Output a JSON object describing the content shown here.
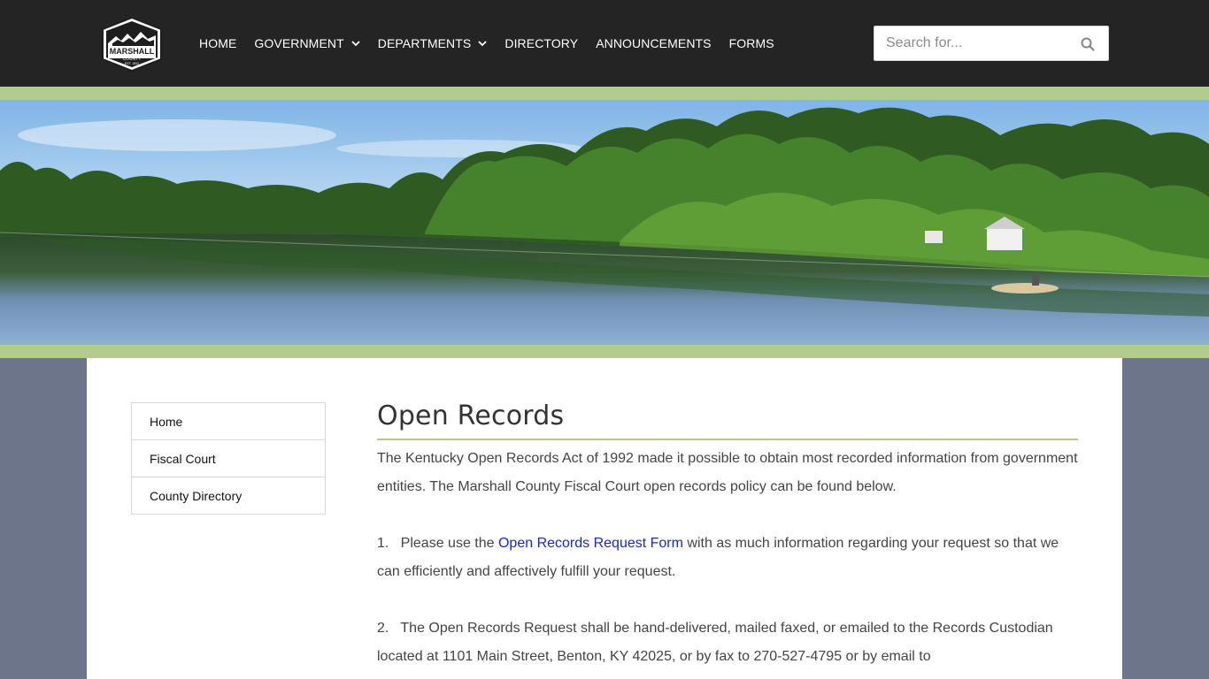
{
  "header": {
    "logo": {
      "name": "MARSHALL",
      "sub": "COUNTY",
      "est": "EST. 1842"
    },
    "nav": [
      {
        "label": "HOME",
        "dropdown": false
      },
      {
        "label": "GOVERNMENT",
        "dropdown": true
      },
      {
        "label": "DEPARTMENTS",
        "dropdown": true
      },
      {
        "label": "DIRECTORY",
        "dropdown": false
      },
      {
        "label": "ANNOUNCEMENTS",
        "dropdown": false
      },
      {
        "label": "FORMS",
        "dropdown": false
      }
    ],
    "search": {
      "placeholder": "Search for..."
    }
  },
  "sidebar": {
    "items": [
      {
        "label": "Home"
      },
      {
        "label": "Fiscal Court"
      },
      {
        "label": "County Directory"
      }
    ]
  },
  "main": {
    "title": "Open Records",
    "intro": "The Kentucky Open Records Act of 1992 made it possible to obtain most recorded information from government entities. The Marshall County Fiscal Court open records policy can be found below.",
    "step1": {
      "prefix": "1.   Please use the ",
      "link": "Open Records Request Form",
      "suffix": " with as much information regarding your request so that we can efficiently and affectively fulfill your request."
    },
    "step2": "2.   The Open Records Request shall be hand-delivered, mailed faxed, or emailed to the Records Custodian located at 1101 Main Street, Benton, KY 42025, or by fax to 270-527-4795 or by email to"
  },
  "colors": {
    "header_bg": "#242424",
    "accent_band": "#b1cc8e",
    "page_bg": "#6c7589",
    "link": "#1a28c4"
  }
}
